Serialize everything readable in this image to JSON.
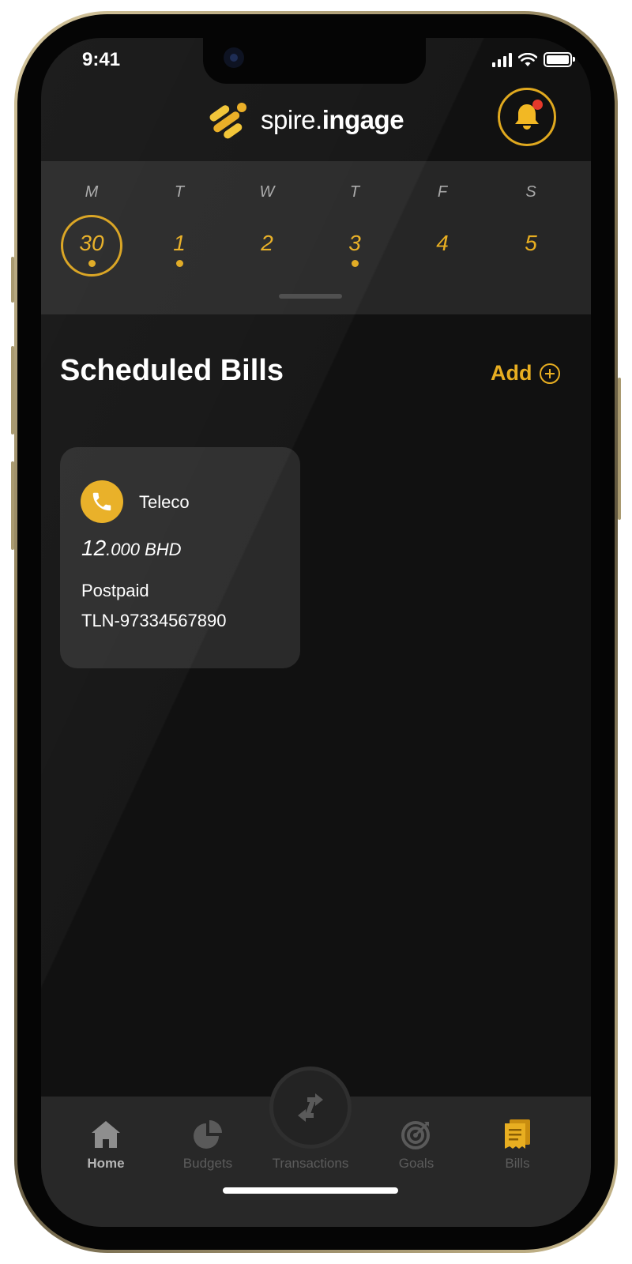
{
  "status_bar": {
    "time": "9:41"
  },
  "header": {
    "logo_prefix": "spire.",
    "logo_bold": "ingage",
    "notification_badge_color": "#e5392b",
    "accent": "#e8ae21"
  },
  "calendar": {
    "days": [
      {
        "letter": "M",
        "date": "30",
        "selected": true,
        "has_event": true
      },
      {
        "letter": "T",
        "date": "1",
        "selected": false,
        "has_event": true
      },
      {
        "letter": "W",
        "date": "2",
        "selected": false,
        "has_event": false
      },
      {
        "letter": "T",
        "date": "3",
        "selected": false,
        "has_event": true
      },
      {
        "letter": "F",
        "date": "4",
        "selected": false,
        "has_event": false
      },
      {
        "letter": "S",
        "date": "5",
        "selected": false,
        "has_event": false
      }
    ]
  },
  "bills_section": {
    "title": "Scheduled Bills",
    "add_label": "Add"
  },
  "bill_card": {
    "icon": "phone-icon",
    "name": "Teleco",
    "amount_int": "12",
    "amount_dec": ".000 BHD",
    "type": "Postpaid",
    "account": "TLN-97334567890"
  },
  "tabbar": {
    "items": [
      {
        "label": "Home",
        "icon": "home-icon"
      },
      {
        "label": "Budgets",
        "icon": "pie-chart-icon"
      },
      {
        "label": "Transactions",
        "icon": "transfer-icon"
      },
      {
        "label": "Goals",
        "icon": "target-icon"
      },
      {
        "label": "Bills",
        "icon": "receipt-icon"
      }
    ]
  }
}
